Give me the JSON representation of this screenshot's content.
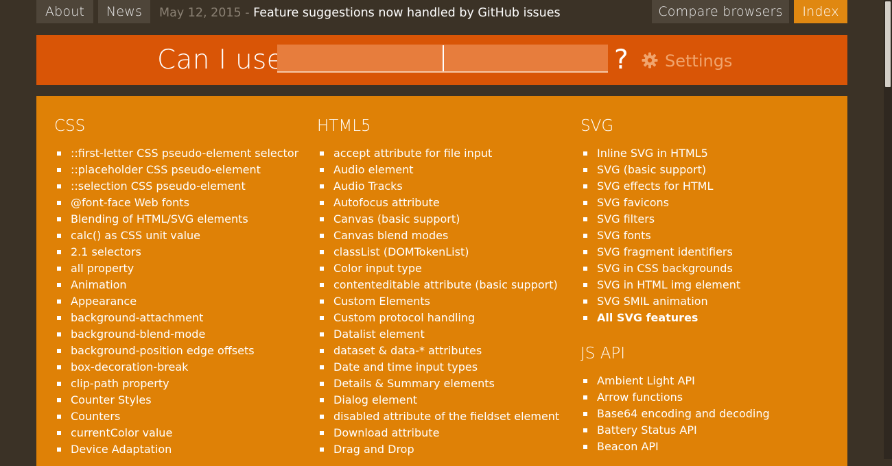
{
  "nav": {
    "about": "About",
    "news": "News",
    "compare": "Compare browsers",
    "index": "Index"
  },
  "news": {
    "date": "May 12, 2015",
    "separator": "-",
    "text": "Feature suggestions now handled by GitHub issues"
  },
  "search": {
    "label": "Can I use",
    "value": "",
    "question": "?",
    "settings_label": "Settings"
  },
  "categories": {
    "css": {
      "title": "CSS",
      "items": [
        "::first-letter CSS pseudo-element selector",
        "::placeholder CSS pseudo-element",
        "::selection CSS pseudo-element",
        "@font-face Web fonts",
        "Blending of HTML/SVG elements",
        "calc() as CSS unit value",
        "2.1 selectors",
        "all property",
        "Animation",
        "Appearance",
        "background-attachment",
        "background-blend-mode",
        "background-position edge offsets",
        "box-decoration-break",
        "clip-path property",
        "Counter Styles",
        "Counters",
        "currentColor value",
        "Device Adaptation"
      ]
    },
    "html5": {
      "title": "HTML5",
      "items": [
        "accept attribute for file input",
        "Audio element",
        "Audio Tracks",
        "Autofocus attribute",
        "Canvas (basic support)",
        "Canvas blend modes",
        "classList (DOMTokenList)",
        "Color input type",
        "contenteditable attribute (basic support)",
        "Custom Elements",
        "Custom protocol handling",
        "Datalist element",
        "dataset & data-* attributes",
        "Date and time input types",
        "Details & Summary elements",
        "Dialog element",
        "disabled attribute of the fieldset element",
        "Download attribute",
        "Drag and Drop"
      ]
    },
    "svg": {
      "title": "SVG",
      "items": [
        "Inline SVG in HTML5",
        "SVG (basic support)",
        "SVG effects for HTML",
        "SVG favicons",
        "SVG filters",
        "SVG fonts",
        "SVG fragment identifiers",
        "SVG in CSS backgrounds",
        "SVG in HTML img element",
        "SVG SMIL animation"
      ],
      "all_label": "All SVG features"
    },
    "jsapi": {
      "title": "JS API",
      "items": [
        "Ambient Light API",
        "Arrow functions",
        "Base64 encoding and decoding",
        "Battery Status API",
        "Beacon API"
      ]
    }
  },
  "colors": {
    "background": "#3b3226",
    "header": "#d95506",
    "panel": "#df8106",
    "active_nav": "#e08811"
  },
  "icons": {
    "settings": "gear-icon"
  }
}
